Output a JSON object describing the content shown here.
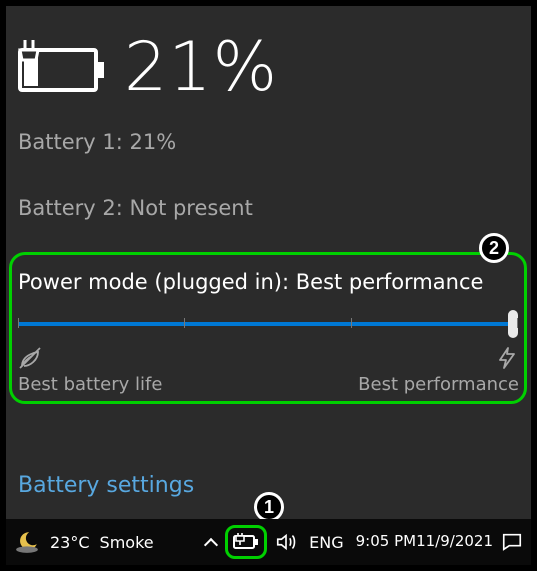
{
  "header": {
    "percent_text": "21%",
    "fill_fraction": 0.21
  },
  "batteries": {
    "line1": "Battery 1: 21%",
    "line2": "Battery 2: Not present"
  },
  "power_mode": {
    "label": "Power mode (plugged in): Best performance",
    "slider_value": 2,
    "slider_max": 2,
    "left_caption": "Best battery life",
    "right_caption": "Best performance"
  },
  "link": {
    "battery_settings": "Battery settings"
  },
  "taskbar": {
    "weather_temp": "23°C",
    "weather_cond": "Smoke",
    "lang": "ENG",
    "clock_time": "9:05 PM",
    "clock_date": "11/9/2021"
  },
  "annotations": {
    "one": "1",
    "two": "2"
  },
  "colors": {
    "accent": "#0078d4",
    "highlight": "#00d000",
    "link": "#58a8e0"
  }
}
